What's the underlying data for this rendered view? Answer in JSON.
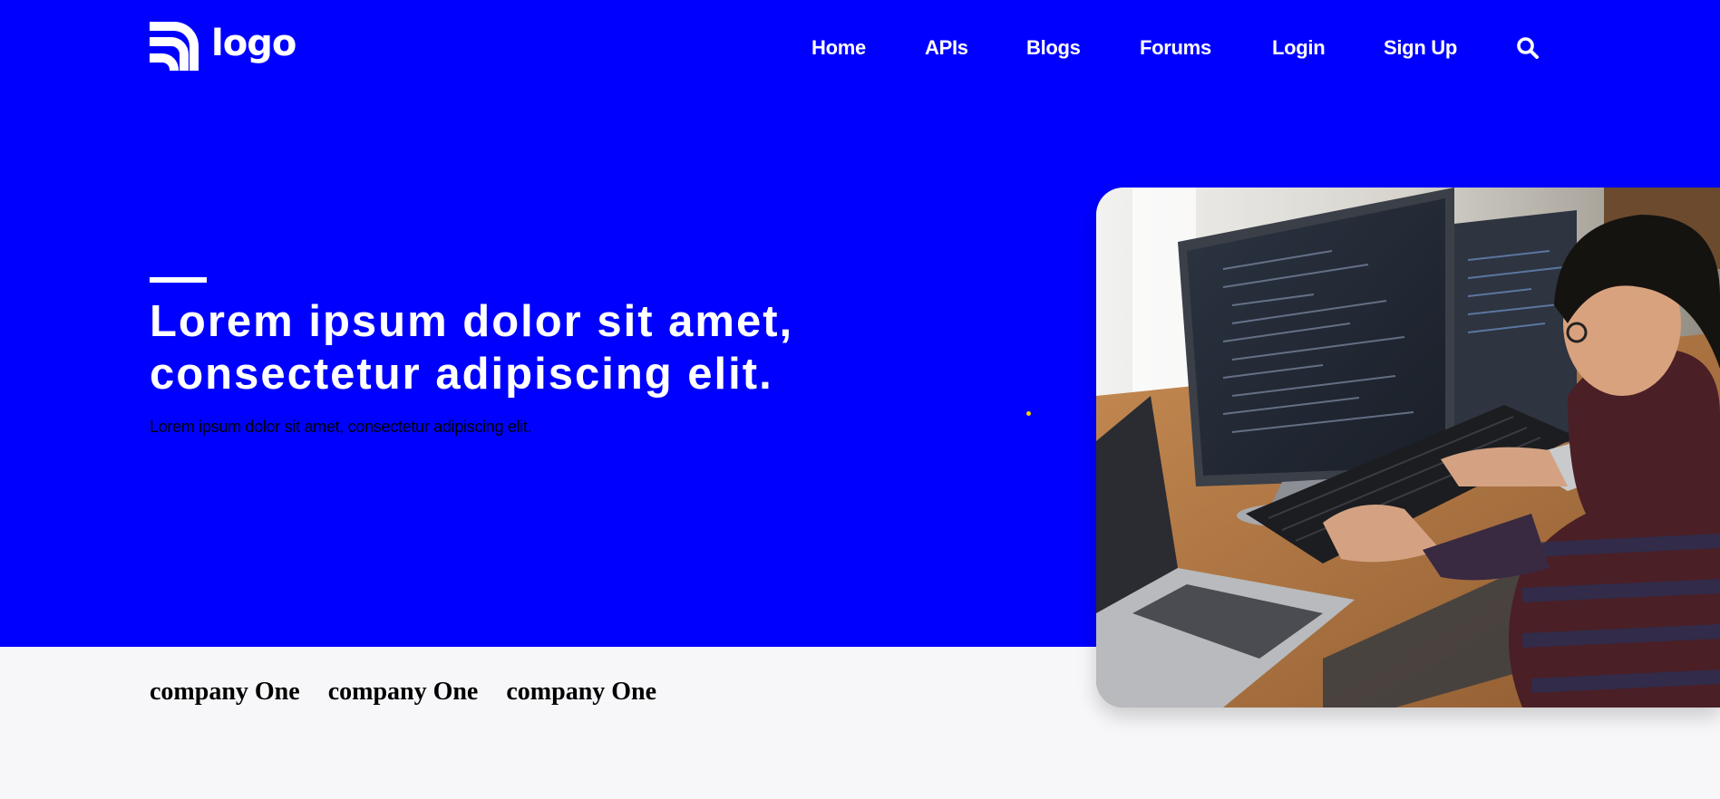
{
  "brand": {
    "logo_text": "logo",
    "logo_icon": "rss-arcs-icon",
    "primary_color": "#0000ff",
    "text_color": "#ffffff",
    "footer_bg": "#f7f7f9"
  },
  "nav": {
    "items": [
      {
        "label": "Home"
      },
      {
        "label": "APIs"
      },
      {
        "label": "Blogs"
      },
      {
        "label": "Forums"
      },
      {
        "label": "Login"
      },
      {
        "label": "Sign Up"
      }
    ],
    "search_icon": "search-icon"
  },
  "hero": {
    "headline_line1": "Lorem ipsum dolor sit amet,",
    "headline_line2": "consectetur adipiscing elit.",
    "subtext": "Lorem ipsum dolor sit amet, consectetur adipiscing elit.",
    "image_subject": "developer-at-desk-photo"
  },
  "companies": {
    "items": [
      {
        "name": "company One"
      },
      {
        "name": "company One"
      },
      {
        "name": "company One"
      }
    ]
  }
}
